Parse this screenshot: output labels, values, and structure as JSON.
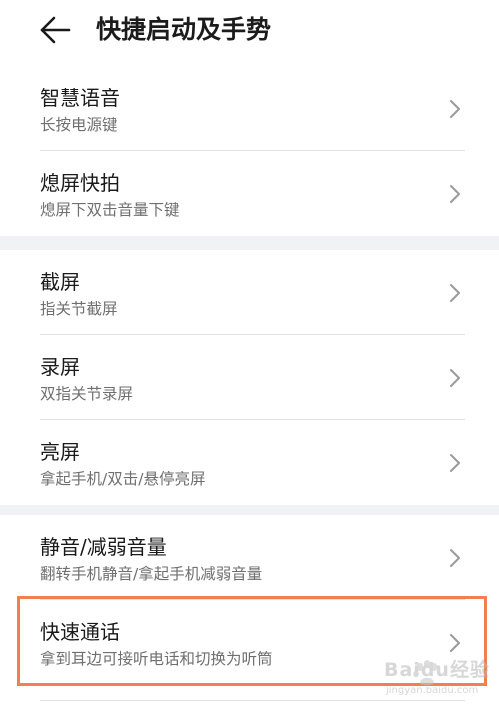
{
  "header": {
    "title": "快捷启动及手势",
    "back_icon": "arrow-left-icon"
  },
  "groups": [
    {
      "items": [
        {
          "title": "智慧语音",
          "subtitle": "长按电源键"
        },
        {
          "title": "熄屏快拍",
          "subtitle": "熄屏下双击音量下键"
        }
      ]
    },
    {
      "items": [
        {
          "title": "截屏",
          "subtitle": "指关节截屏"
        },
        {
          "title": "录屏",
          "subtitle": "双指关节录屏"
        },
        {
          "title": "亮屏",
          "subtitle": "拿起手机/双击/悬停亮屏"
        }
      ]
    },
    {
      "items": [
        {
          "title": "静音/减弱音量",
          "subtitle": "翻转手机静音/拿起手机减弱音量"
        },
        {
          "title": "快速通话",
          "subtitle": "拿到耳边可接听电话和切换为听筒"
        }
      ]
    }
  ],
  "colors": {
    "highlight_border": "#f07f52",
    "group_gap": "#f1f2f4"
  },
  "watermark": {
    "brand": "Baidu经验",
    "url": "jingyan.baidu.com"
  }
}
